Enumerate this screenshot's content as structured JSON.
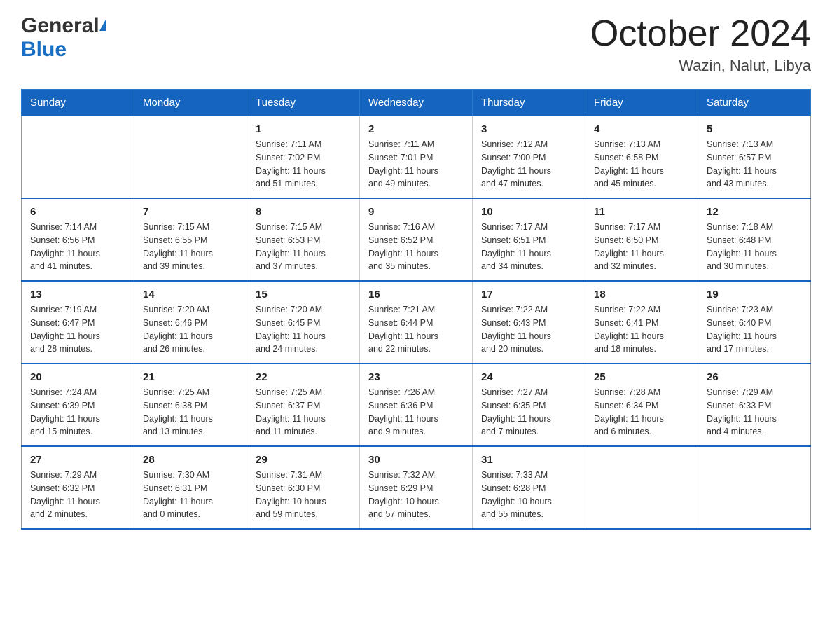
{
  "header": {
    "logo_general": "General",
    "logo_blue": "Blue",
    "month_title": "October 2024",
    "location": "Wazin, Nalut, Libya"
  },
  "days_of_week": [
    "Sunday",
    "Monday",
    "Tuesday",
    "Wednesday",
    "Thursday",
    "Friday",
    "Saturday"
  ],
  "weeks": [
    [
      {
        "day": "",
        "info": ""
      },
      {
        "day": "",
        "info": ""
      },
      {
        "day": "1",
        "info": "Sunrise: 7:11 AM\nSunset: 7:02 PM\nDaylight: 11 hours\nand 51 minutes."
      },
      {
        "day": "2",
        "info": "Sunrise: 7:11 AM\nSunset: 7:01 PM\nDaylight: 11 hours\nand 49 minutes."
      },
      {
        "day": "3",
        "info": "Sunrise: 7:12 AM\nSunset: 7:00 PM\nDaylight: 11 hours\nand 47 minutes."
      },
      {
        "day": "4",
        "info": "Sunrise: 7:13 AM\nSunset: 6:58 PM\nDaylight: 11 hours\nand 45 minutes."
      },
      {
        "day": "5",
        "info": "Sunrise: 7:13 AM\nSunset: 6:57 PM\nDaylight: 11 hours\nand 43 minutes."
      }
    ],
    [
      {
        "day": "6",
        "info": "Sunrise: 7:14 AM\nSunset: 6:56 PM\nDaylight: 11 hours\nand 41 minutes."
      },
      {
        "day": "7",
        "info": "Sunrise: 7:15 AM\nSunset: 6:55 PM\nDaylight: 11 hours\nand 39 minutes."
      },
      {
        "day": "8",
        "info": "Sunrise: 7:15 AM\nSunset: 6:53 PM\nDaylight: 11 hours\nand 37 minutes."
      },
      {
        "day": "9",
        "info": "Sunrise: 7:16 AM\nSunset: 6:52 PM\nDaylight: 11 hours\nand 35 minutes."
      },
      {
        "day": "10",
        "info": "Sunrise: 7:17 AM\nSunset: 6:51 PM\nDaylight: 11 hours\nand 34 minutes."
      },
      {
        "day": "11",
        "info": "Sunrise: 7:17 AM\nSunset: 6:50 PM\nDaylight: 11 hours\nand 32 minutes."
      },
      {
        "day": "12",
        "info": "Sunrise: 7:18 AM\nSunset: 6:48 PM\nDaylight: 11 hours\nand 30 minutes."
      }
    ],
    [
      {
        "day": "13",
        "info": "Sunrise: 7:19 AM\nSunset: 6:47 PM\nDaylight: 11 hours\nand 28 minutes."
      },
      {
        "day": "14",
        "info": "Sunrise: 7:20 AM\nSunset: 6:46 PM\nDaylight: 11 hours\nand 26 minutes."
      },
      {
        "day": "15",
        "info": "Sunrise: 7:20 AM\nSunset: 6:45 PM\nDaylight: 11 hours\nand 24 minutes."
      },
      {
        "day": "16",
        "info": "Sunrise: 7:21 AM\nSunset: 6:44 PM\nDaylight: 11 hours\nand 22 minutes."
      },
      {
        "day": "17",
        "info": "Sunrise: 7:22 AM\nSunset: 6:43 PM\nDaylight: 11 hours\nand 20 minutes."
      },
      {
        "day": "18",
        "info": "Sunrise: 7:22 AM\nSunset: 6:41 PM\nDaylight: 11 hours\nand 18 minutes."
      },
      {
        "day": "19",
        "info": "Sunrise: 7:23 AM\nSunset: 6:40 PM\nDaylight: 11 hours\nand 17 minutes."
      }
    ],
    [
      {
        "day": "20",
        "info": "Sunrise: 7:24 AM\nSunset: 6:39 PM\nDaylight: 11 hours\nand 15 minutes."
      },
      {
        "day": "21",
        "info": "Sunrise: 7:25 AM\nSunset: 6:38 PM\nDaylight: 11 hours\nand 13 minutes."
      },
      {
        "day": "22",
        "info": "Sunrise: 7:25 AM\nSunset: 6:37 PM\nDaylight: 11 hours\nand 11 minutes."
      },
      {
        "day": "23",
        "info": "Sunrise: 7:26 AM\nSunset: 6:36 PM\nDaylight: 11 hours\nand 9 minutes."
      },
      {
        "day": "24",
        "info": "Sunrise: 7:27 AM\nSunset: 6:35 PM\nDaylight: 11 hours\nand 7 minutes."
      },
      {
        "day": "25",
        "info": "Sunrise: 7:28 AM\nSunset: 6:34 PM\nDaylight: 11 hours\nand 6 minutes."
      },
      {
        "day": "26",
        "info": "Sunrise: 7:29 AM\nSunset: 6:33 PM\nDaylight: 11 hours\nand 4 minutes."
      }
    ],
    [
      {
        "day": "27",
        "info": "Sunrise: 7:29 AM\nSunset: 6:32 PM\nDaylight: 11 hours\nand 2 minutes."
      },
      {
        "day": "28",
        "info": "Sunrise: 7:30 AM\nSunset: 6:31 PM\nDaylight: 11 hours\nand 0 minutes."
      },
      {
        "day": "29",
        "info": "Sunrise: 7:31 AM\nSunset: 6:30 PM\nDaylight: 10 hours\nand 59 minutes."
      },
      {
        "day": "30",
        "info": "Sunrise: 7:32 AM\nSunset: 6:29 PM\nDaylight: 10 hours\nand 57 minutes."
      },
      {
        "day": "31",
        "info": "Sunrise: 7:33 AM\nSunset: 6:28 PM\nDaylight: 10 hours\nand 55 minutes."
      },
      {
        "day": "",
        "info": ""
      },
      {
        "day": "",
        "info": ""
      }
    ]
  ]
}
